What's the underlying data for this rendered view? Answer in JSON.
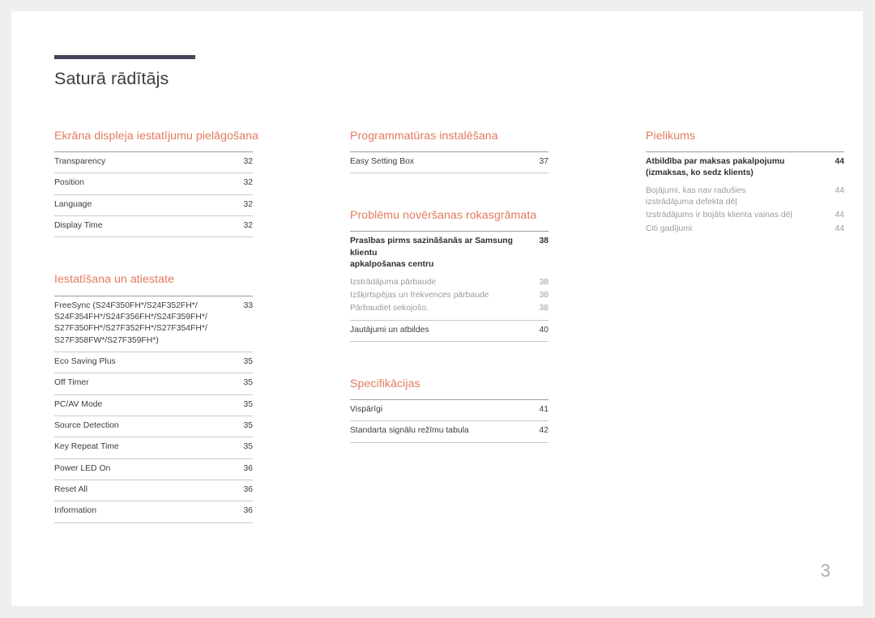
{
  "document": {
    "title": "Saturā rādītājs",
    "page_number": "3",
    "accent_color": "#e37b5d",
    "rule_color": "#474459"
  },
  "columns": [
    {
      "sections": [
        {
          "heading": "Ekrāna displeja iestatījumu pielāgošana",
          "entries": [
            {
              "label": "Transparency",
              "page": "32",
              "style": "normal"
            },
            {
              "label": "Position",
              "page": "32",
              "style": "normal"
            },
            {
              "label": "Language",
              "page": "32",
              "style": "normal"
            },
            {
              "label": "Display Time",
              "page": "32",
              "style": "normal"
            }
          ]
        },
        {
          "heading": "Iestatīšana un atiestate",
          "entries": [
            {
              "label": "FreeSync (S24F350FH*/S24F352FH*/\nS24F354FH*/S24F356FH*/S24F359FH*/\nS27F350FH*/S27F352FH*/S27F354FH*/\nS27F358FW*/S27F359FH*)",
              "page": "33",
              "style": "normal"
            },
            {
              "label": "Eco Saving Plus",
              "page": "35",
              "style": "normal"
            },
            {
              "label": "Off Timer",
              "page": "35",
              "style": "normal"
            },
            {
              "label": "PC/AV Mode",
              "page": "35",
              "style": "normal"
            },
            {
              "label": "Source Detection",
              "page": "35",
              "style": "normal"
            },
            {
              "label": "Key Repeat Time",
              "page": "35",
              "style": "normal"
            },
            {
              "label": "Power LED On",
              "page": "36",
              "style": "normal"
            },
            {
              "label": "Reset All",
              "page": "36",
              "style": "normal"
            },
            {
              "label": "Information",
              "page": "36",
              "style": "normal"
            }
          ]
        }
      ]
    },
    {
      "sections": [
        {
          "heading": "Programmatūras instalēšana",
          "entries": [
            {
              "label": "Easy Setting Box",
              "page": "37",
              "style": "normal"
            }
          ]
        },
        {
          "heading": "Problēmu novēršanas rokasgrāmata",
          "entries": [
            {
              "label": "Prasības pirms sazināšanās ar Samsung klientu\napkalpošanas centru",
              "page": "38",
              "style": "strong"
            },
            {
              "label": "Izstrādājuma pārbaude",
              "page": "38",
              "style": "sub"
            },
            {
              "label": "Izšķirtspējas un frekvences pārbaude",
              "page": "38",
              "style": "sub"
            },
            {
              "label": "Pārbaudiet sekojošo.",
              "page": "38",
              "style": "sub"
            },
            {
              "label": "Jautājumi un atbildes",
              "page": "40",
              "style": "normal"
            }
          ]
        },
        {
          "heading": "Specifikācijas",
          "entries": [
            {
              "label": "Vispārīgi",
              "page": "41",
              "style": "normal"
            },
            {
              "label": "Standarta signālu režīmu tabula",
              "page": "42",
              "style": "normal"
            }
          ]
        }
      ]
    },
    {
      "sections": [
        {
          "heading": "Pielikums",
          "entries": [
            {
              "label": "Atbildība par maksas pakalpojumu\n(izmaksas, ko sedz klients)",
              "page": "44",
              "style": "strong"
            },
            {
              "label": "Bojājumi, kas nav radušies\nizstrādājuma defekta dēļ",
              "page": "44",
              "style": "sub"
            },
            {
              "label": "Izstrādājums ir bojāts klienta vainas dēļ",
              "page": "44",
              "style": "sub"
            },
            {
              "label": "Citi gadījumi",
              "page": "44",
              "style": "sub"
            }
          ]
        }
      ]
    }
  ]
}
